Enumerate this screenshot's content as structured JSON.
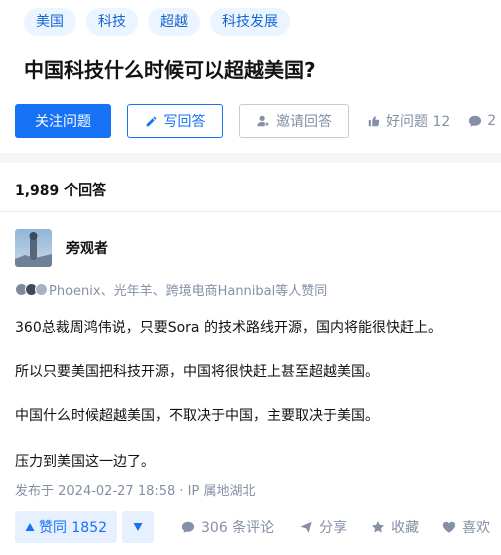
{
  "tags": [
    "美国",
    "科技",
    "超越",
    "科技发展"
  ],
  "question": {
    "title": "中国科技什么时候可以超越美国?"
  },
  "actions": {
    "follow": "关注问题",
    "write": "写回答",
    "invite": "邀请回答",
    "good_question": "好问题 12",
    "comments_partial": "2"
  },
  "answers": {
    "count_label": "1,989 个回答"
  },
  "answer": {
    "author": "旁观者",
    "voters": "Phoenix、光年羊、跨境电商Hannibal等人赞同",
    "paragraphs": [
      "360总裁周鸿伟说，只要Sora 的技术路线开源，国内将能很快赶上。",
      "所以只要美国把科技开源，中国将很快赶上甚至超越美国。",
      "中国什么时候超越美国，不取决于中国，主要取决于美国。",
      "压力到美国这一边了。"
    ],
    "post_time": "发布于 2024-02-27 18:58 · IP 属地湖北"
  },
  "bottom_bar": {
    "upvote": "赞同 1852",
    "comments": "306 条评论",
    "share": "分享",
    "favorite": "收藏",
    "like": "喜欢"
  },
  "colors": {
    "brand": "#1772f6",
    "tag_bg": "#ebf5ff",
    "muted": "#8590a6"
  },
  "icons": [
    "pencil-icon",
    "invite-user-icon",
    "thumb-up-icon",
    "comment-icon",
    "triangle-up-icon",
    "triangle-down-icon",
    "share-icon",
    "star-icon",
    "heart-icon"
  ]
}
